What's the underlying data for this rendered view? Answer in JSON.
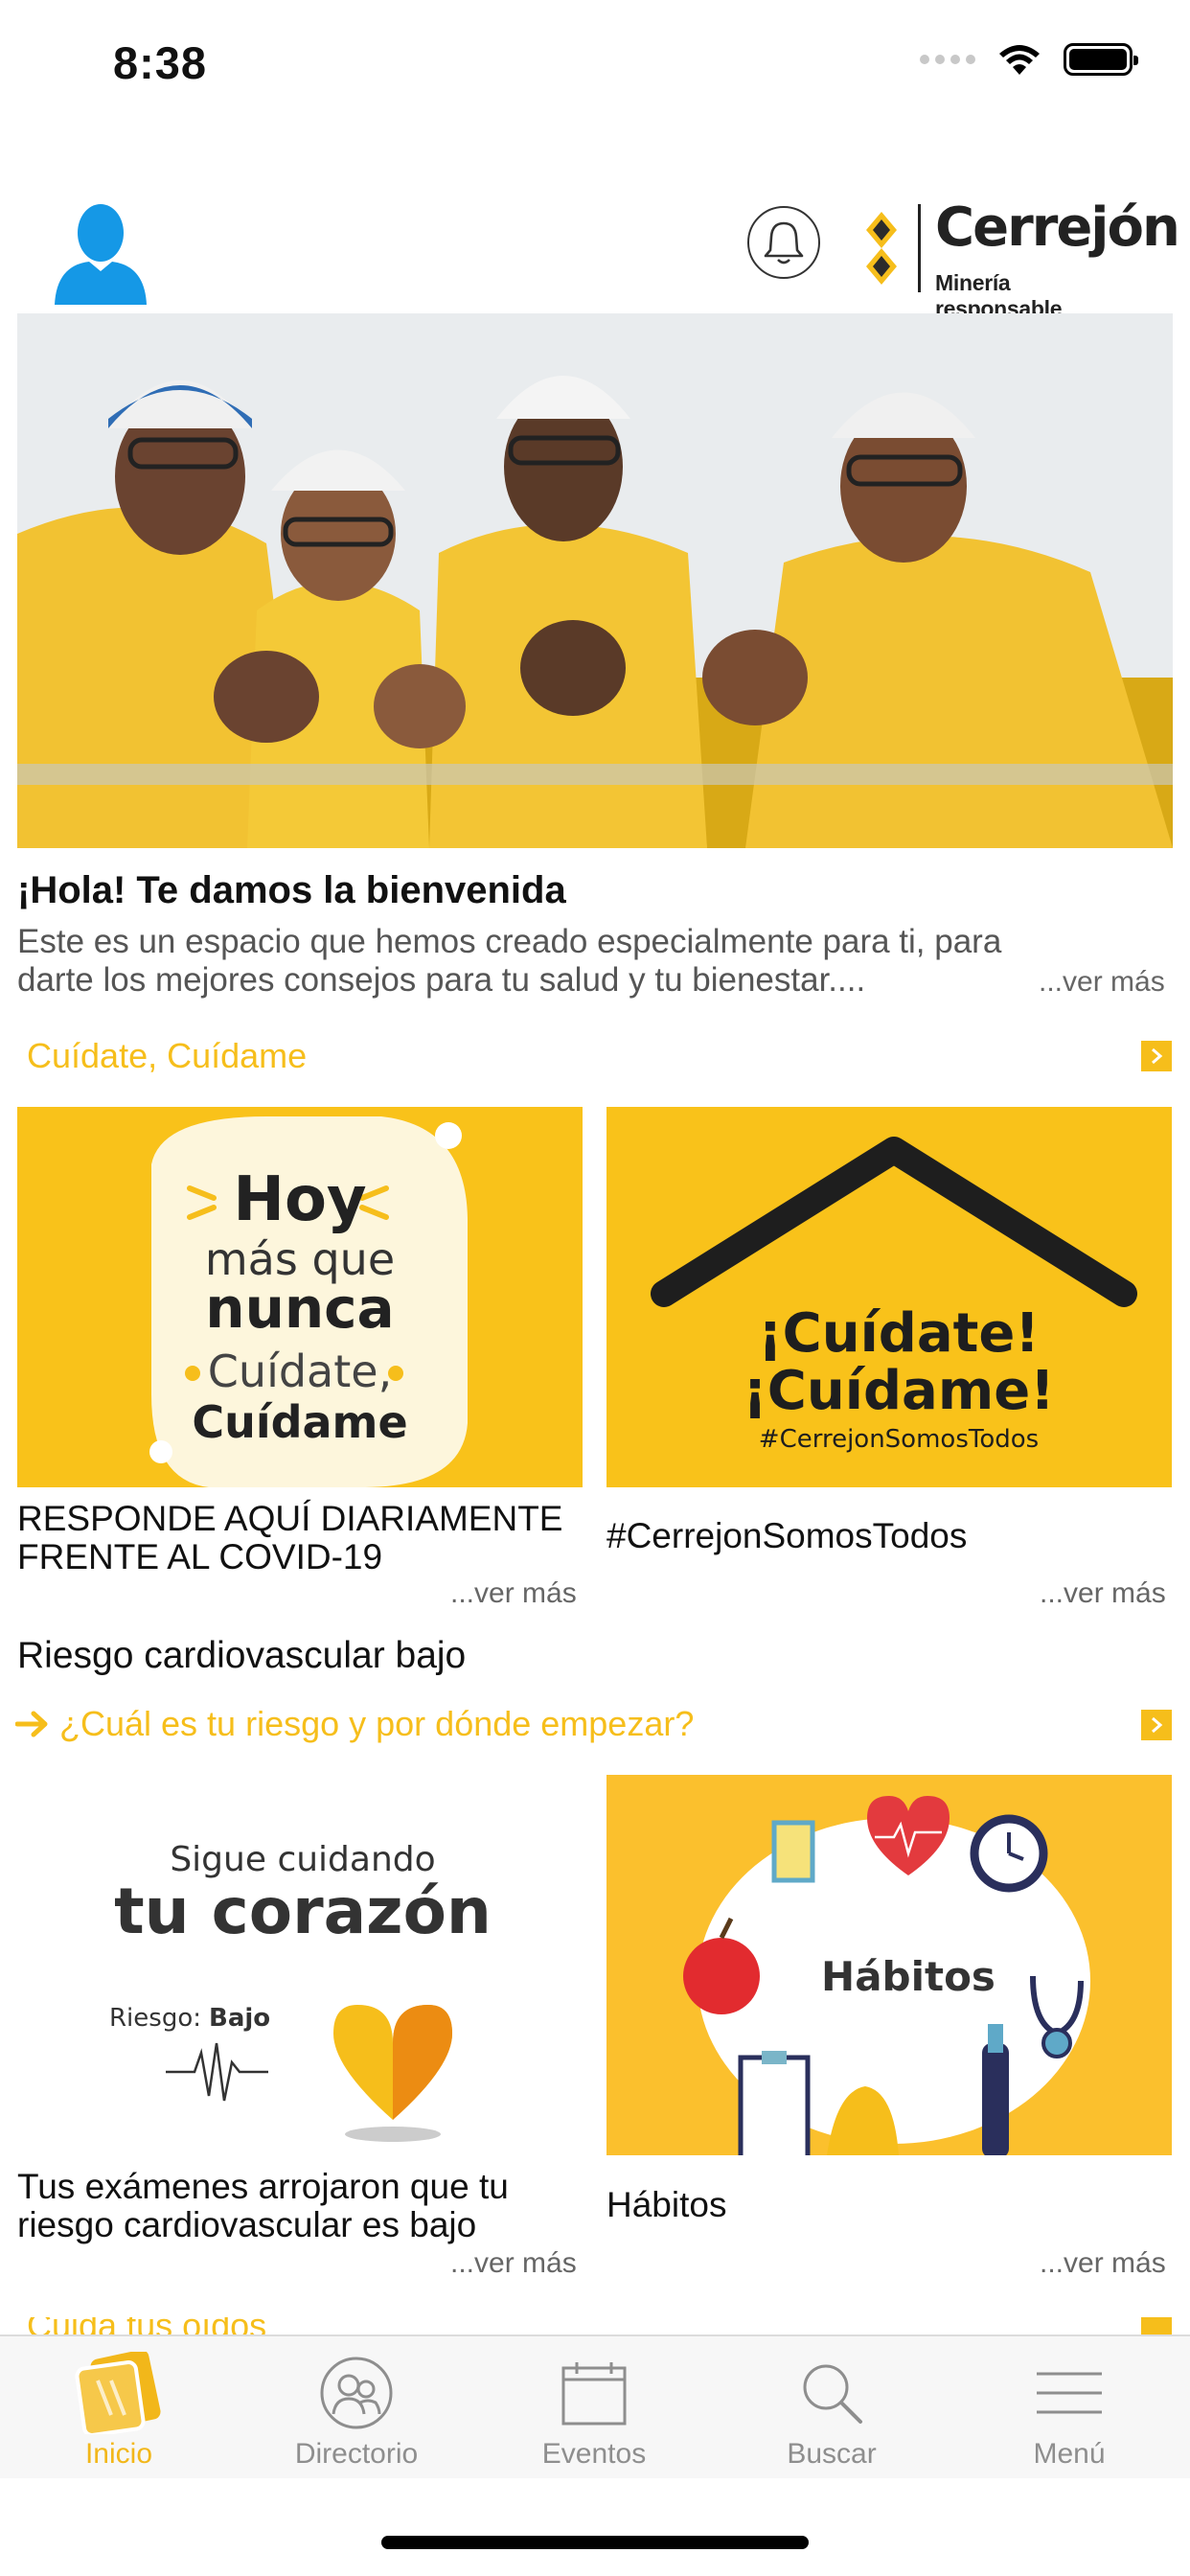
{
  "status_bar": {
    "time": "8:38"
  },
  "header": {
    "logo_name": "Cerrejón",
    "logo_tagline": "Minería responsable"
  },
  "welcome": {
    "title": "¡Hola! Te damos la bienvenida",
    "text": "Este es un espacio que hemos creado especialmente para ti, para darte los mejores consejos para tu salud y tu bienestar....",
    "more": "...ver más"
  },
  "section1": {
    "link": "Cuídate, Cuídame",
    "cards": [
      {
        "image_text": {
          "l1": "Hoy",
          "l2": "más que",
          "l3": "nunca",
          "l4": "Cuídate,",
          "l5": "Cuídame"
        },
        "caption": "RESPONDE AQUÍ DIARIAMENTE FRENTE AL COVID-19",
        "more": "...ver más"
      },
      {
        "image_text": {
          "l1": "¡Cuídate!",
          "l2": "¡Cuídame!",
          "l3": "#CerrejonSomosTodos"
        },
        "caption": "#CerrejonSomosTodos",
        "more": "...ver más"
      }
    ]
  },
  "section2": {
    "title": "Riesgo cardiovascular bajo",
    "link": "¿Cuál es tu riesgo y por dónde empezar?",
    "cards": [
      {
        "image_text": {
          "l1": "Sigue cuidando",
          "l2": "tu corazón",
          "risk_label": "Riesgo:",
          "risk_value": "Bajo"
        },
        "caption": "Tus exámenes arrojaron que tu riesgo cardiovascular es bajo",
        "more": "...ver más"
      },
      {
        "image_text": {
          "l1": "Hábitos"
        },
        "caption": "Hábitos",
        "more": "...ver más"
      }
    ]
  },
  "section3": {
    "link": "Cuida tus oídos"
  },
  "tabbar": {
    "tabs": [
      {
        "label": "Inicio",
        "icon": "home-cards-icon",
        "active": true
      },
      {
        "label": "Directorio",
        "icon": "people-icon",
        "active": false
      },
      {
        "label": "Eventos",
        "icon": "calendar-icon",
        "active": false
      },
      {
        "label": "Buscar",
        "icon": "search-icon",
        "active": false
      },
      {
        "label": "Menú",
        "icon": "menu-icon",
        "active": false
      }
    ]
  },
  "colors": {
    "accent": "#f6be1b",
    "card_yellow": "#fbc02d",
    "avatar_blue": "#1598e6"
  }
}
